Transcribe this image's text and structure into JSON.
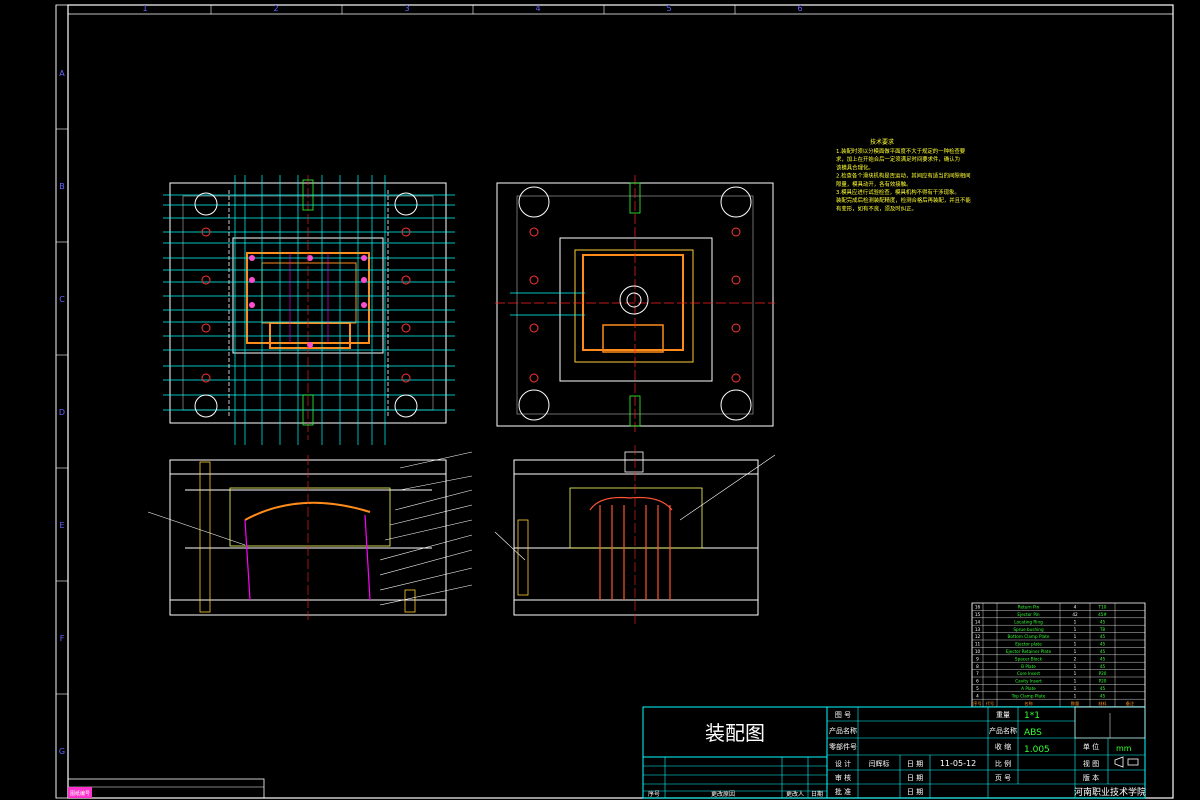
{
  "border": {
    "columns": [
      "1",
      "2",
      "3",
      "4",
      "5",
      "6"
    ],
    "rows": [
      "A",
      "B",
      "C",
      "D",
      "E",
      "F",
      "G"
    ]
  },
  "tech_notes": {
    "title": "技术要求",
    "lines": [
      "1.装配时须以分模面做平面度不大于规定的一种检查要",
      "求，加上在开始合后一定须满足时间要求件，确认为",
      "该模具合理化。",
      "2.检查各个滑块机构是否运动，其间应有适当的间隙相间",
      "隙量，模具动开，各有效接触。",
      "3.模具应进行试验检查，模具机构不得有干涉现象。",
      "装配完成后检测装配精度，检测合格后再装配，并且不能",
      "有变形，如有不良，须及时纠正。"
    ]
  },
  "bom": {
    "rows": [
      [
        "16",
        "",
        "Return Pin",
        "4",
        "T10",
        ""
      ],
      [
        "15",
        "",
        "Ejector Pin",
        "42",
        "45#",
        ""
      ],
      [
        "14",
        "",
        "Locating Ring",
        "1",
        "45",
        ""
      ],
      [
        "13",
        "",
        "Sprue bushing",
        "1",
        "T8",
        ""
      ],
      [
        "12",
        "",
        "Bottom Clamp Plate",
        "1",
        "45",
        ""
      ],
      [
        "11",
        "",
        "Ejector plate",
        "1",
        "45",
        ""
      ],
      [
        "10",
        "",
        "Ejector Retainer Plate",
        "1",
        "45",
        ""
      ],
      [
        "9",
        "",
        "Spacer Block",
        "2",
        "45",
        ""
      ],
      [
        "8",
        "",
        "B Plate",
        "1",
        "45",
        ""
      ],
      [
        "7",
        "",
        "Core Insert",
        "1",
        "P20",
        ""
      ],
      [
        "6",
        "",
        "Cavity Insert",
        "1",
        "P20",
        ""
      ],
      [
        "5",
        "",
        "A Plate",
        "1",
        "45",
        ""
      ],
      [
        "4",
        "",
        "Top Clamp Plate",
        "1",
        "45",
        ""
      ]
    ],
    "header": [
      "序号",
      "代号",
      "名称",
      "数量",
      "材料",
      "备注"
    ]
  },
  "title_block": {
    "drawing_name": "装配图",
    "labels": {
      "draw_no": "图 号",
      "product_name": "产品名称",
      "draw_part": "零部件号",
      "design": "设 计",
      "check": "审 核",
      "approve": "批 准",
      "scale_label": "比 例",
      "page_label": "页 号",
      "weight_label": "重量",
      "qty_label": "数 量",
      "shrink_label": "收 缩",
      "unit_label": "单 位",
      "proj_label": "视 图",
      "version_label": "版 本",
      "date_label": "日 期"
    },
    "values": {
      "cavity_count": "1*1",
      "material": "ABS",
      "shrinkage": "1.005",
      "unit": "mm",
      "designer": "闫辉标",
      "date": "11-05-12",
      "school": "河南职业技术学院"
    },
    "revision_header": [
      "序号",
      "更改原因",
      "更改人",
      "日期"
    ]
  },
  "corner_tag": "图纸编号"
}
